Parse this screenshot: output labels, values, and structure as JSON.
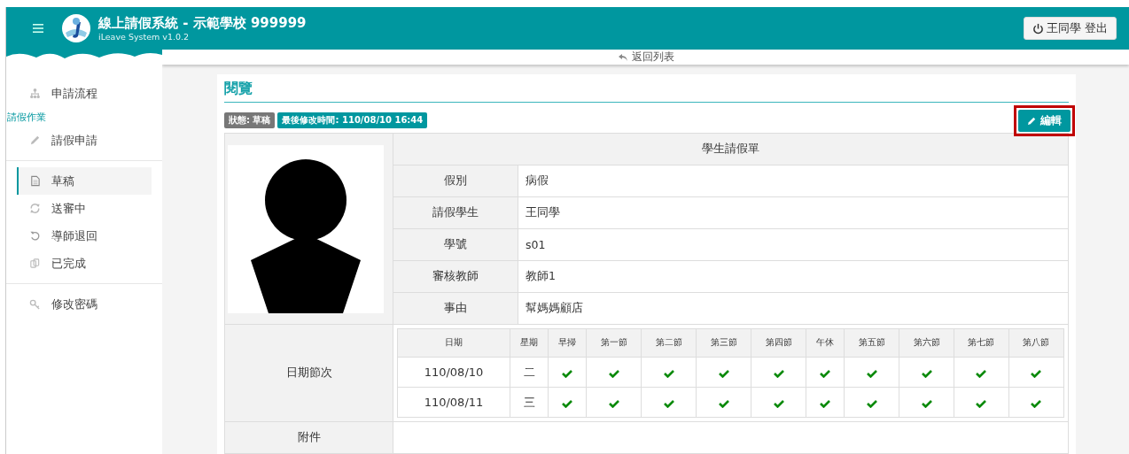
{
  "header": {
    "title": "線上請假系統 - 示範學校 999999",
    "subtitle": "iLeave System v1.0.2",
    "logout": "王同學 登出"
  },
  "sidebar": {
    "groups": [
      [
        {
          "kind": "link",
          "label": "申請流程",
          "selected": false
        },
        {
          "kind": "heading",
          "label": "請假作業"
        },
        {
          "kind": "link",
          "label": "請假申請",
          "selected": false
        }
      ],
      [
        {
          "kind": "link",
          "label": "草稿",
          "selected": true
        },
        {
          "kind": "link",
          "label": "送審中",
          "selected": false
        },
        {
          "kind": "link",
          "label": "導師退回",
          "selected": false
        },
        {
          "kind": "link",
          "label": "已完成",
          "selected": false
        }
      ],
      [
        {
          "kind": "link",
          "label": "修改密碼",
          "selected": false
        }
      ]
    ]
  },
  "back_link": "返回列表",
  "card": {
    "title": "閱覽",
    "badges": [
      {
        "text": "狀態: 草稿",
        "color": "#777777"
      },
      {
        "text": "最後修改時間: 110/08/10 16:44",
        "color": "#00979f"
      }
    ],
    "edit_button": {
      "label": "編輯",
      "highlighted": true
    },
    "form": {
      "title": "學生請假單",
      "fields": [
        {
          "label": "假別",
          "value": "病假"
        },
        {
          "label": "請假學生",
          "value": "王同學"
        },
        {
          "label": "學號",
          "value": "s01"
        },
        {
          "label": "審核教師",
          "value": "教師1"
        },
        {
          "label": "事由",
          "value": "幫媽媽顧店"
        }
      ],
      "schedule_label": "日期節次",
      "schedule": {
        "columns": [
          "日期",
          "星期",
          "早掃",
          "第一節",
          "第二節",
          "第三節",
          "第四節",
          "午休",
          "第五節",
          "第六節",
          "第七節",
          "第八節"
        ],
        "rows": [
          {
            "date": "110/08/10",
            "weekday": "二",
            "periods": [
              {
                "checked": true
              },
              {
                "checked": true
              },
              {
                "checked": true
              },
              {
                "checked": true
              },
              {
                "checked": true
              },
              {
                "checked": true
              },
              {
                "checked": true
              },
              {
                "checked": true
              },
              {
                "checked": true
              },
              {
                "checked": true
              }
            ]
          },
          {
            "date": "110/08/11",
            "weekday": "三",
            "periods": [
              {
                "checked": true
              },
              {
                "checked": true
              },
              {
                "checked": true
              },
              {
                "checked": true
              },
              {
                "checked": true
              },
              {
                "checked": true
              },
              {
                "checked": true
              },
              {
                "checked": true
              },
              {
                "checked": true
              },
              {
                "checked": true
              }
            ]
          }
        ]
      },
      "attachment_label": "附件"
    }
  }
}
